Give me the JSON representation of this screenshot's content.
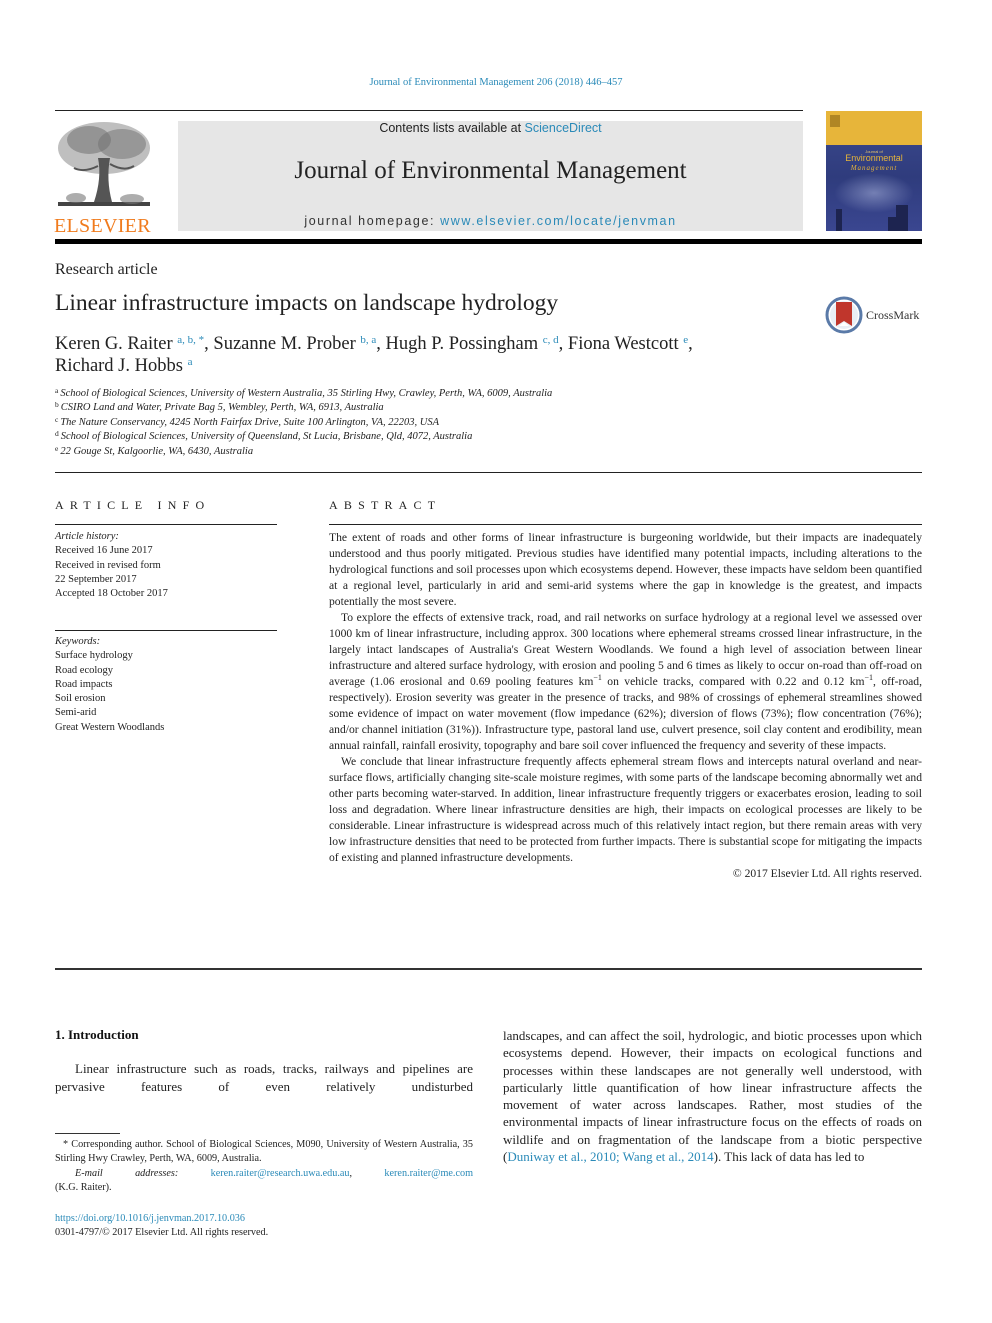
{
  "header": {
    "citation": "Journal of Environmental Management 206 (2018) 446–457",
    "publisher_logo_text": "ELSEVIER",
    "contents_prefix": "Contents lists available at ",
    "contents_link": "ScienceDirect",
    "journal_title": "Journal of Environmental Management",
    "homepage_prefix": "journal homepage: ",
    "homepage_link": "www.elsevier.com/locate/jenvman",
    "cover": {
      "kicker": "Journal of",
      "title_line1": "Environmental",
      "title_line2": "Management"
    },
    "colors": {
      "link": "#2a8ab8",
      "elsevier_orange": "#f07b1d",
      "masthead_gray": "#e6e6e6"
    }
  },
  "article": {
    "type": "Research article",
    "title": "Linear infrastructure impacts on landscape hydrology",
    "crossmark_label": "CrossMark",
    "authors": [
      {
        "name": "Keren G. Raiter",
        "sup": "a, b, *",
        "sep": ", "
      },
      {
        "name": "Suzanne M. Prober",
        "sup": "b, a",
        "sep": ", "
      },
      {
        "name": "Hugh P. Possingham",
        "sup": "c, d",
        "sep": ", "
      },
      {
        "name": "Fiona Westcott",
        "sup": "e",
        "sep": ","
      },
      {
        "name": "Richard J. Hobbs",
        "sup": "a",
        "sep": ""
      }
    ],
    "affiliations": [
      {
        "key": "a",
        "text": "School of Biological Sciences, University of Western Australia, 35 Stirling Hwy, Crawley, Perth, WA, 6009, Australia"
      },
      {
        "key": "b",
        "text": "CSIRO Land and Water, Private Bag 5, Wembley, Perth, WA, 6913, Australia"
      },
      {
        "key": "c",
        "text": "The Nature Conservancy, 4245 North Fairfax Drive, Suite 100 Arlington, VA, 22203, USA"
      },
      {
        "key": "d",
        "text": "School of Biological Sciences, University of Queensland, St Lucia, Brisbane, Qld, 4072, Australia"
      },
      {
        "key": "e",
        "text": "22 Gouge St, Kalgoorlie, WA, 6430, Australia"
      }
    ]
  },
  "article_info": {
    "heading": "ARTICLE INFO",
    "history_label": "Article history:",
    "history": [
      "Received 16 June 2017",
      "Received in revised form",
      "22 September 2017",
      "Accepted 18 October 2017"
    ],
    "keywords_label": "Keywords:",
    "keywords": [
      "Surface hydrology",
      "Road ecology",
      "Road impacts",
      "Soil erosion",
      "Semi-arid",
      "Great Western Woodlands"
    ]
  },
  "abstract": {
    "heading": "ABSTRACT",
    "p1": "The extent of roads and other forms of linear infrastructure is burgeoning worldwide, but their impacts are inadequately understood and thus poorly mitigated. Previous studies have identified many potential impacts, including alterations to the hydrological functions and soil processes upon which ecosystems depend. However, these impacts have seldom been quantified at a regional level, particularly in arid and semi-arid systems where the gap in knowledge is the greatest, and impacts potentially the most severe.",
    "p2_a": "To explore the effects of extensive track, road, and rail networks on surface hydrology at a regional level we assessed over 1000 km of linear infrastructure, including approx. 300 locations where ephemeral streams crossed linear infrastructure, in the largely intact landscapes of Australia's Great Western Woodlands. We found a high level of association between linear infrastructure and altered surface hydrology, with erosion and pooling 5 and 6 times as likely to occur on-road than off-road on average (1.06 erosional and 0.69 pooling features km",
    "p2_sup1": "−1",
    "p2_b": " on vehicle tracks, compared with 0.22 and 0.12 km",
    "p2_sup2": "−1",
    "p2_c": ", off-road, respectively). Erosion severity was greater in the presence of tracks, and 98% of crossings of ephemeral streamlines showed some evidence of impact on water movement (flow impedance (62%); diversion of flows (73%); flow concentration (76%); and/or channel initiation (31%)). Infrastructure type, pastoral land use, culvert presence, soil clay content and erodibility, mean annual rainfall, rainfall erosivity, topography and bare soil cover influenced the frequency and severity of these impacts.",
    "p3": "We conclude that linear infrastructure frequently affects ephemeral stream flows and intercepts natural overland and near-surface flows, artificially changing site-scale moisture regimes, with some parts of the landscape becoming abnormally wet and other parts becoming water-starved. In addition, linear infrastructure frequently triggers or exacerbates erosion, leading to soil loss and degradation. Where linear infrastructure densities are high, their impacts on ecological processes are likely to be considerable. Linear infrastructure is widespread across much of this relatively intact region, but there remain areas with very low infrastructure densities that need to be protected from further impacts. There is substantial scope for mitigating the impacts of existing and planned infrastructure developments.",
    "copyright": "© 2017 Elsevier Ltd. All rights reserved."
  },
  "introduction": {
    "heading": "1.  Introduction",
    "left_text": "Linear infrastructure such as roads, tracks, railways and pipelines are pervasive features of even relatively undisturbed",
    "right_text_a": "landscapes, and can affect the soil, hydrologic, and biotic processes upon which ecosystems depend. However, their impacts on ecological functions and processes within these landscapes are not generally well understood, with particularly little quantification of how linear infrastructure affects the movement of water across landscapes. Rather, most studies of the environmental impacts of linear infrastructure focus on the effects of roads on wildlife and on fragmentation of the landscape from a biotic perspective (",
    "right_citation": "Duniway et al., 2010; Wang et al., 2014",
    "right_text_b": "). This lack of data has led to"
  },
  "footnote": {
    "corresponding": "* Corresponding author. School of Biological Sciences, M090, University of Western Australia, 35 Stirling Hwy Crawley, Perth, WA, 6009, Australia.",
    "email_label": "E-mail addresses:",
    "email1": "keren.raiter@research.uwa.edu.au",
    "email_sep": ", ",
    "email2": "keren.raiter@me.com",
    "email_owner": "(K.G. Raiter).",
    "doi": "https://doi.org/10.1016/j.jenvman.2017.10.036",
    "issn_copyright": "0301-4797/© 2017 Elsevier Ltd. All rights reserved."
  }
}
